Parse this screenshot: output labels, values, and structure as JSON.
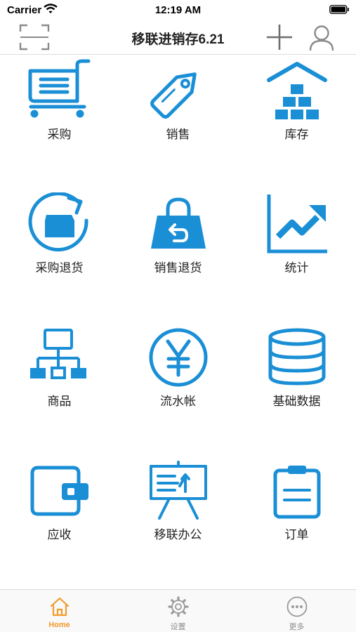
{
  "status_bar": {
    "carrier": "Carrier",
    "time": "12:19 AM"
  },
  "nav": {
    "title": "移联进销存6.21"
  },
  "grid": {
    "accent_color": "#1a8fd6",
    "items": [
      {
        "label": "采购",
        "icon": "shopping-cart-icon"
      },
      {
        "label": "销售",
        "icon": "price-tag-icon"
      },
      {
        "label": "库存",
        "icon": "warehouse-icon"
      },
      {
        "label": "采购退货",
        "icon": "return-box-icon"
      },
      {
        "label": "销售退货",
        "icon": "return-bag-icon"
      },
      {
        "label": "统计",
        "icon": "trend-chart-icon"
      },
      {
        "label": "商品",
        "icon": "hierarchy-icon"
      },
      {
        "label": "流水帐",
        "icon": "yen-coin-icon"
      },
      {
        "label": "基础数据",
        "icon": "database-icon"
      },
      {
        "label": "应收",
        "icon": "wallet-icon"
      },
      {
        "label": "移联办公",
        "icon": "presentation-board-icon"
      },
      {
        "label": "订单",
        "icon": "clipboard-icon"
      }
    ]
  },
  "tabs": {
    "active_color": "#f39a2b",
    "items": [
      {
        "label": "Home",
        "icon": "home-icon",
        "active": true
      },
      {
        "label": "设置",
        "icon": "gear-icon",
        "active": false
      },
      {
        "label": "更多",
        "icon": "more-dots-icon",
        "active": false
      }
    ]
  }
}
